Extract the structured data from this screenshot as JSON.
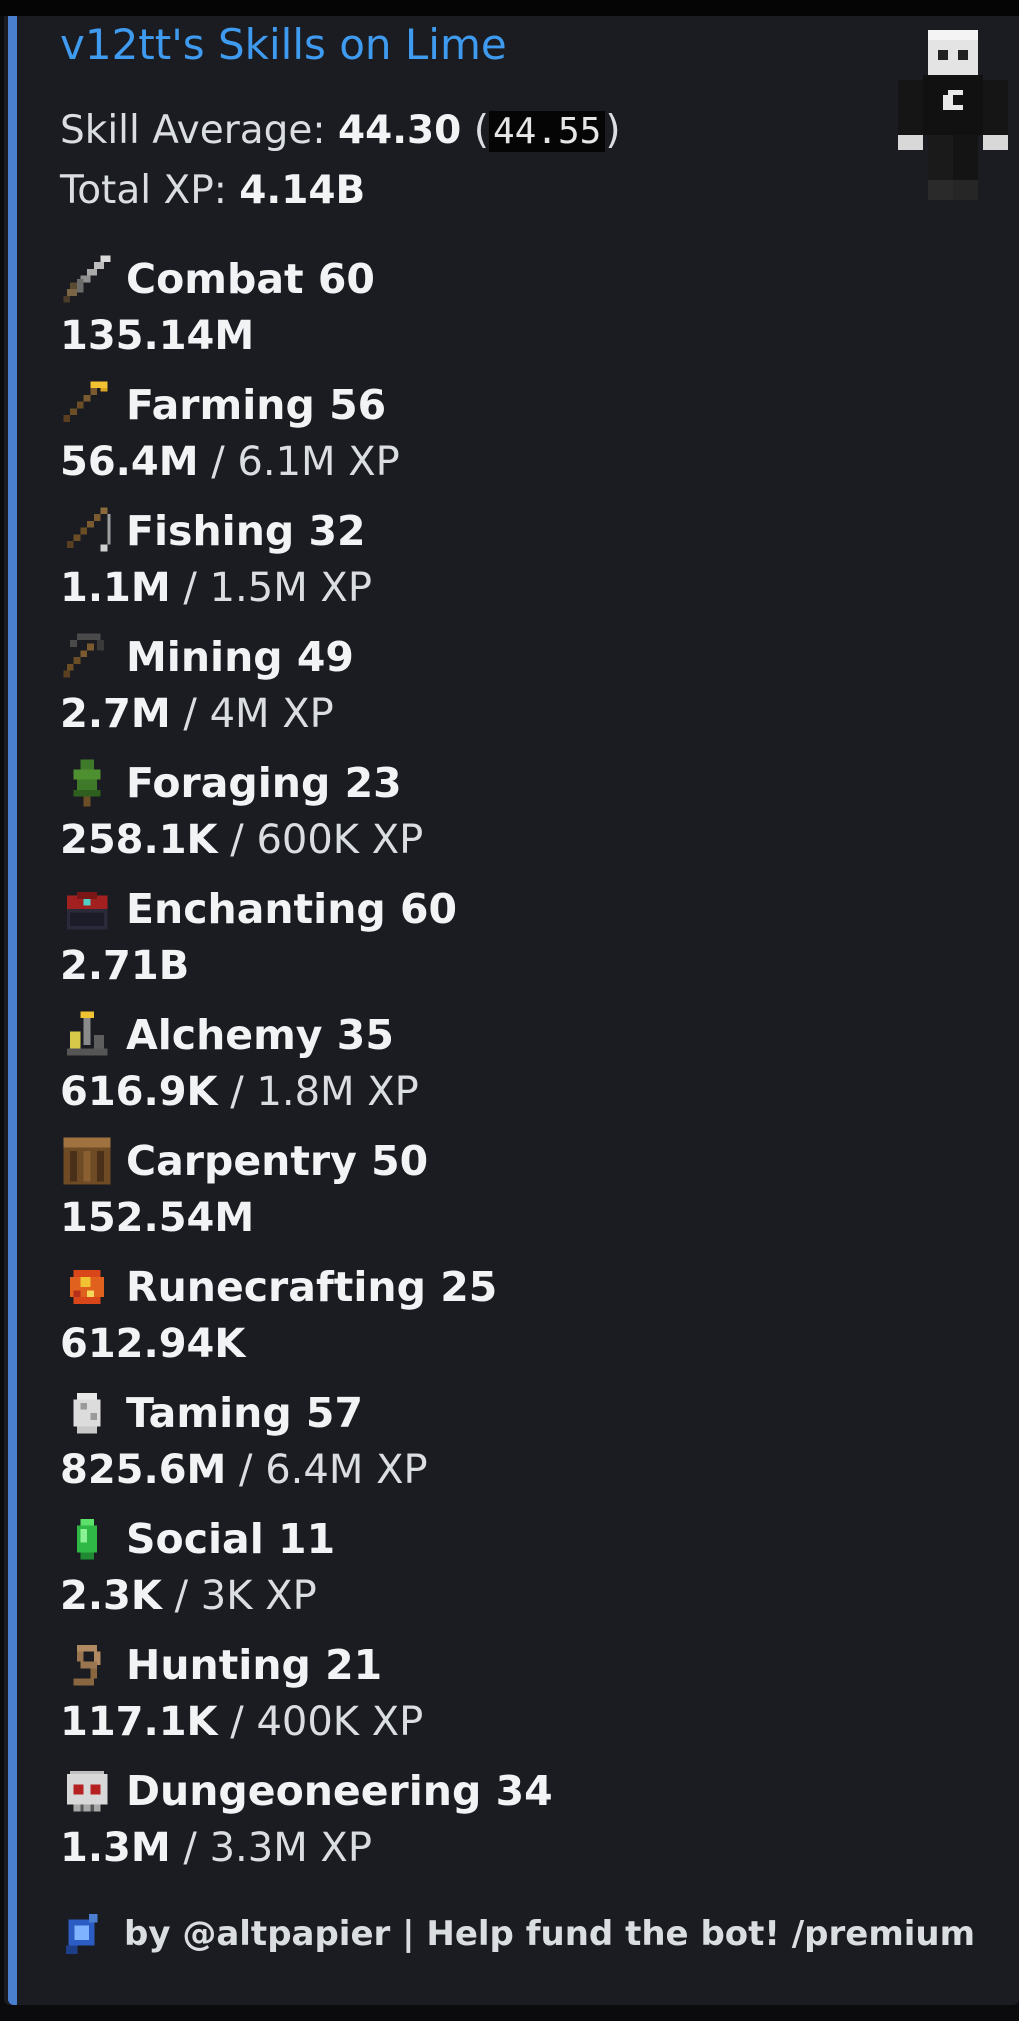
{
  "embed": {
    "title": "v12tt's Skills on Lime",
    "skill_average_label": "Skill Average: ",
    "skill_average_value": "44.30",
    "skill_average_open": " (",
    "skill_average_alt": "44.55",
    "skill_average_close": ")",
    "total_xp_label": "Total XP: ",
    "total_xp_value": "4.14B",
    "accent_color": "#4a7fd0",
    "title_color": "#3f9bf0"
  },
  "skills": [
    {
      "name": "Combat 60",
      "xp": "135.14M",
      "next": "",
      "icon": "sword-icon"
    },
    {
      "name": "Farming 56",
      "xp": "56.4M",
      "next": " / 6.1M XP",
      "icon": "hoe-icon"
    },
    {
      "name": "Fishing 32",
      "xp": "1.1M",
      "next": " / 1.5M XP",
      "icon": "fishing-rod-icon"
    },
    {
      "name": "Mining 49",
      "xp": "2.7M",
      "next": " / 4M XP",
      "icon": "pickaxe-icon"
    },
    {
      "name": "Foraging 23",
      "xp": "258.1K",
      "next": " / 600K XP",
      "icon": "sapling-icon"
    },
    {
      "name": "Enchanting 60",
      "xp": "2.71B",
      "next": "",
      "icon": "enchanting-table-icon"
    },
    {
      "name": "Alchemy 35",
      "xp": "616.9K",
      "next": " / 1.8M XP",
      "icon": "brewing-stand-icon"
    },
    {
      "name": "Carpentry 50",
      "xp": "152.54M",
      "next": "",
      "icon": "crafting-table-icon"
    },
    {
      "name": "Runecrafting 25",
      "xp": "612.94K",
      "next": "",
      "icon": "magma-cream-icon"
    },
    {
      "name": "Taming 57",
      "xp": "825.6M",
      "next": " / 6.4M XP",
      "icon": "spawn-egg-icon"
    },
    {
      "name": "Social 11",
      "xp": "2.3K",
      "next": " / 3K XP",
      "icon": "emerald-icon"
    },
    {
      "name": "Hunting 21",
      "xp": "117.1K",
      "next": " / 400K XP",
      "icon": "lead-icon"
    },
    {
      "name": "Dungeoneering 34",
      "xp": "1.3M",
      "next": " / 3.3M XP",
      "icon": "skull-icon"
    }
  ],
  "footer": {
    "text": "by @altpapier | Help fund the bot! /premium",
    "icon": "bot-logo-icon"
  }
}
